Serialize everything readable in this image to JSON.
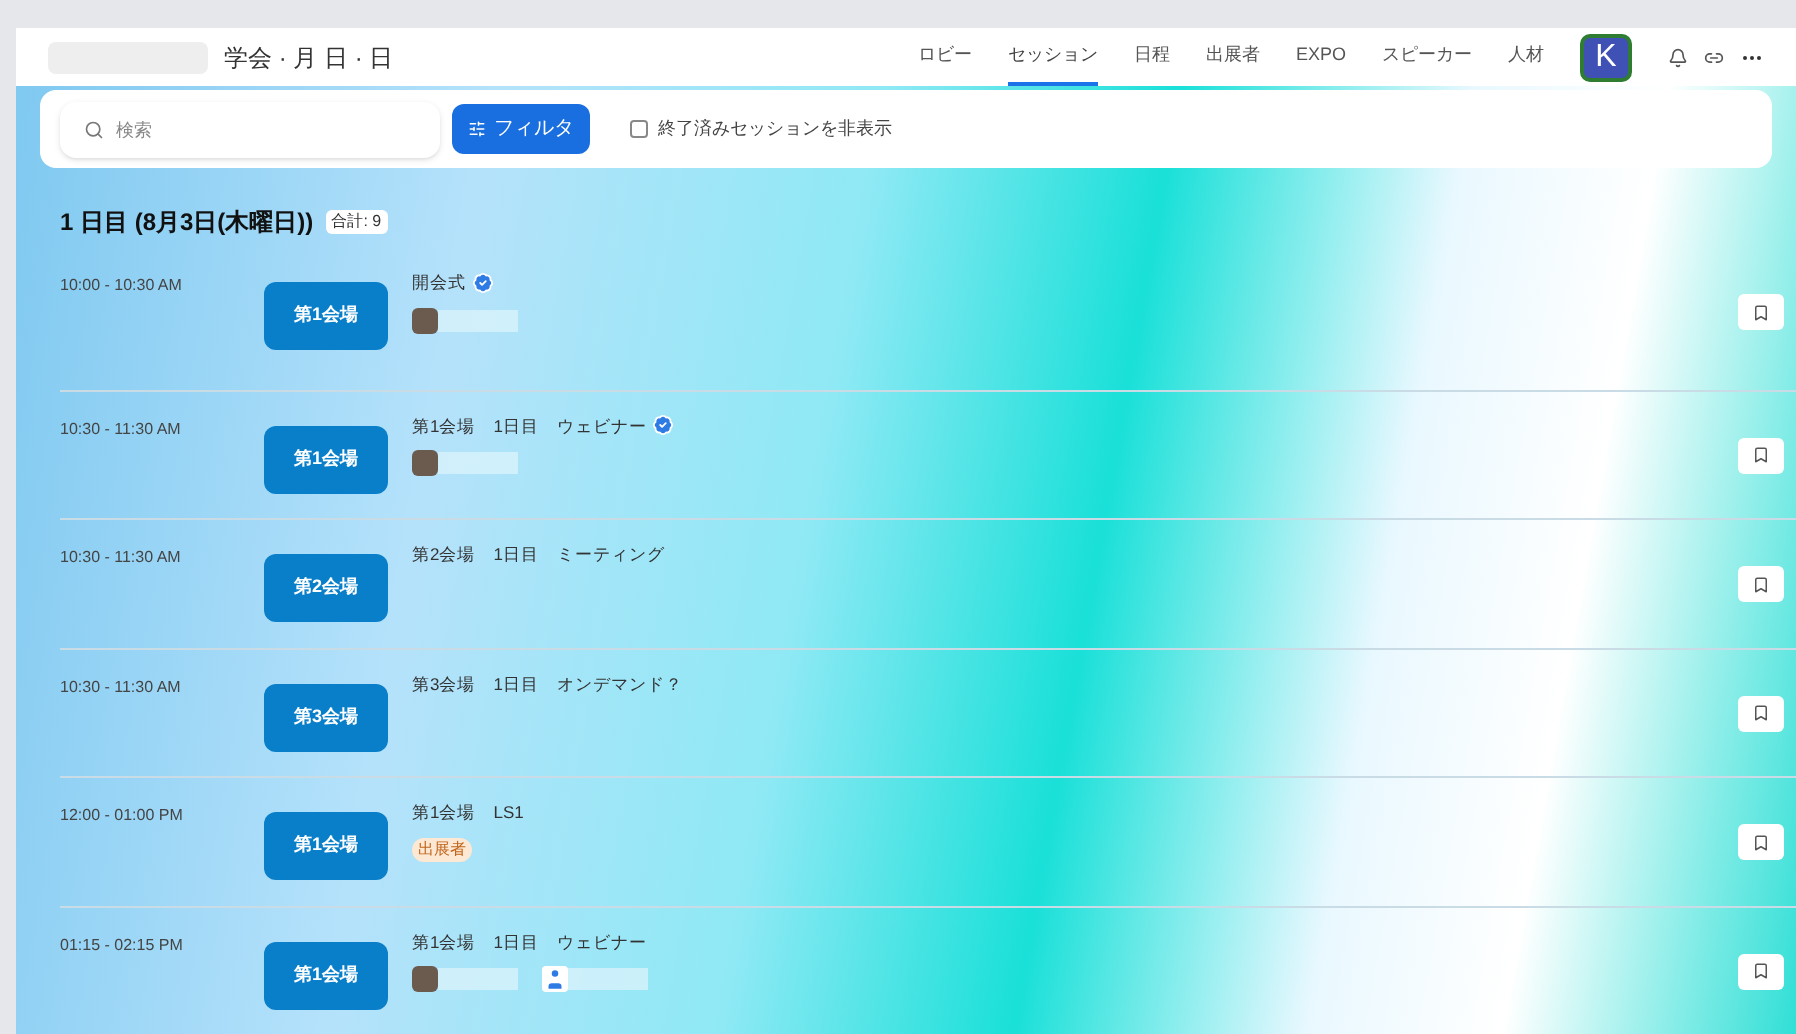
{
  "header": {
    "title": "学会 · 月 日 · 日",
    "nav": [
      {
        "label": "ロビー",
        "selected": false
      },
      {
        "label": "セッション",
        "selected": true
      },
      {
        "label": "日程",
        "selected": false
      },
      {
        "label": "出展者",
        "selected": false
      },
      {
        "label": "EXPO",
        "selected": false
      },
      {
        "label": "スピーカー",
        "selected": false
      },
      {
        "label": "人材",
        "selected": false
      }
    ],
    "avatar": "K"
  },
  "toolbar": {
    "search": {
      "placeholder": "検索"
    },
    "filter_button": "フィルタ",
    "hide_ended": {
      "label": "終了済みセッションを非表示",
      "checked": false
    }
  },
  "day": {
    "heading": "1 日目 (8月3日(木曜日))",
    "total": "合計: 9"
  },
  "sessions": [
    {
      "time": "10:00 - 10:30 AM",
      "venue": "第1会場",
      "title": "開会式",
      "verified": true,
      "speakers": [
        {
          "kind": "photo"
        }
      ]
    },
    {
      "time": "10:30 - 11:30 AM",
      "venue": "第1会場",
      "title": "第1会場　1日目　ウェビナー",
      "verified": true,
      "speakers": [
        {
          "kind": "photo"
        }
      ]
    },
    {
      "time": "10:30 - 11:30 AM",
      "venue": "第2会場",
      "title": "第2会場　1日目　ミーティング",
      "verified": false
    },
    {
      "time": "10:30 - 11:30 AM",
      "venue": "第3会場",
      "title": "第3会場　1日目　オンデマンド？",
      "verified": false
    },
    {
      "time": "12:00 - 01:00 PM",
      "venue": "第1会場",
      "title": "第1会場　LS1",
      "verified": false,
      "tag": "出展者"
    },
    {
      "time": "01:15 - 02:15 PM",
      "venue": "第1会場",
      "title": "第1会場　1日目　ウェビナー",
      "verified": false,
      "speakers": [
        {
          "kind": "photo"
        },
        {
          "kind": "generic"
        }
      ]
    }
  ]
}
